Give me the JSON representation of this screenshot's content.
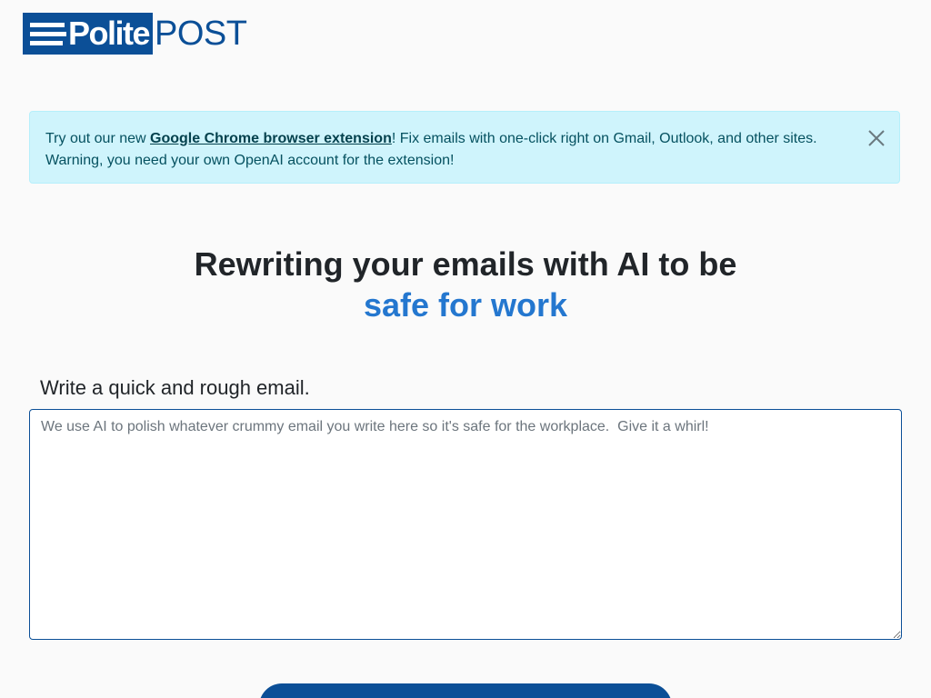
{
  "logo": {
    "polite": "Polite",
    "post": "POST"
  },
  "alert": {
    "prefix": "Try out our new ",
    "link_text": "Google Chrome browser extension",
    "suffix": "! Fix emails with one-click right on Gmail, Outlook, and other sites. Warning, you need your own OpenAI account for the extension!",
    "close_icon": "close-icon"
  },
  "hero": {
    "line1": "Rewriting your emails with AI to be",
    "line2": "safe for work"
  },
  "form": {
    "label": "Write a quick and rough email.",
    "placeholder": "We use AI to polish whatever crummy email you write here so it's safe for the workplace.  Give it a whirl!",
    "value": ""
  },
  "submit": {
    "label": ""
  },
  "colors": {
    "brand": "#0b4f97",
    "accent": "#2477cf",
    "alert_bg": "#cff4fc",
    "alert_text": "#055160"
  }
}
